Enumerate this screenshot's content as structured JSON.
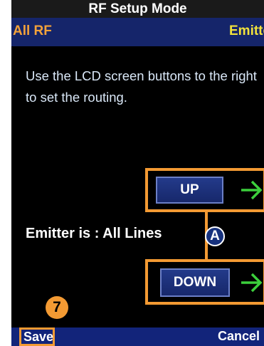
{
  "title": "RF Setup Mode",
  "header": {
    "left_label": "All RF",
    "right_label": "Emitter"
  },
  "instruction": "Use the LCD screen buttons to the right to set the routing.",
  "buttons": {
    "up": "UP",
    "down": "DOWN"
  },
  "status": "Emitter is : All Lines",
  "callouts": {
    "a": "A",
    "seven": "7"
  },
  "softkeys": {
    "save": "Save",
    "cancel": "Cancel"
  },
  "colors": {
    "accent_orange": "#f39a33",
    "arrow_green": "#3ccf3c",
    "header_navy": "#15256a",
    "emitter_yellow": "#f2e23c"
  },
  "icons": {
    "up_arrow": "arrow-right-icon",
    "down_arrow": "arrow-right-icon"
  }
}
